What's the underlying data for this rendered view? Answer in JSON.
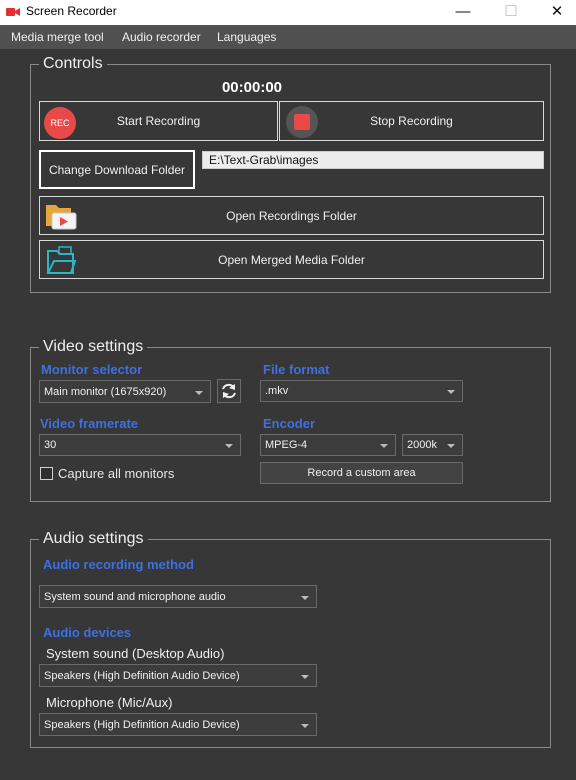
{
  "window": {
    "title": "Screen Recorder",
    "minimize_glyph": "—",
    "maximize_glyph": "☐",
    "close_glyph": "✕"
  },
  "menu": {
    "items": [
      "Media merge tool",
      "Audio recorder",
      "Languages"
    ]
  },
  "controls": {
    "group_title": "Controls",
    "timer": "00:00:00",
    "start_label": "Start Recording",
    "rec_badge": "REC",
    "stop_label": "Stop Recording",
    "change_folder_label": "Change Download Folder",
    "folder_path": "E:\\Text-Grab\\images",
    "open_recordings_label": "Open Recordings Folder",
    "open_merged_label": "Open Merged Media Folder"
  },
  "video": {
    "group_title": "Video settings",
    "monitor_label": "Monitor selector",
    "monitor_value": "Main monitor (1675x920)",
    "format_label": "File format",
    "format_value": ".mkv",
    "framerate_label": "Video framerate",
    "framerate_value": "30",
    "encoder_label": "Encoder",
    "encoder_value": "MPEG-4",
    "bitrate_value": "2000k",
    "capture_all_label": "Capture all monitors",
    "capture_all_checked": false,
    "custom_area_label": "Record a custom area"
  },
  "audio": {
    "group_title": "Audio settings",
    "method_label": "Audio recording method",
    "method_value": "System sound and microphone audio",
    "devices_label": "Audio devices",
    "system_label": "System sound (Desktop Audio)",
    "system_value": "Speakers (High Definition Audio Device)",
    "mic_label": "Microphone (Mic/Aux)",
    "mic_value": "Speakers (High Definition Audio Device)"
  },
  "colors": {
    "accent": "#3f6fe0",
    "record_red": "#e84a4a",
    "background": "#373737",
    "menubar": "#505050"
  }
}
